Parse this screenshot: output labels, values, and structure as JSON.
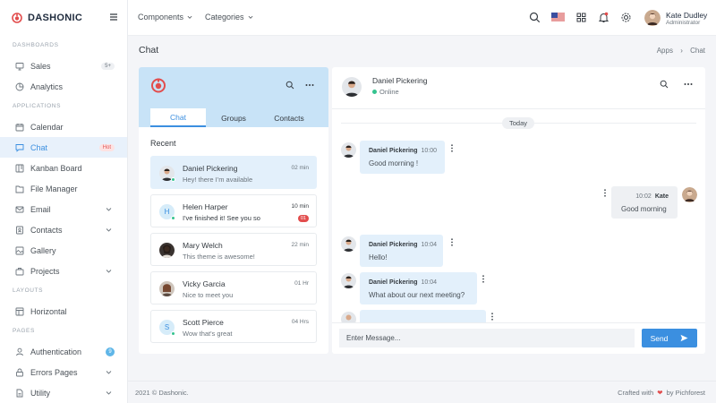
{
  "brand": {
    "name": "DASHONIC",
    "accent": "#e24d4d"
  },
  "sidebar": {
    "sections": [
      {
        "title": "DASHBOARDS"
      },
      {
        "title": "APPLICATIONS"
      },
      {
        "title": "LAYOUTS"
      },
      {
        "title": "PAGES"
      }
    ],
    "items": [
      {
        "label": "Sales",
        "icon": "monitor-icon",
        "badge": "5+"
      },
      {
        "label": "Analytics",
        "icon": "pie-chart-icon"
      },
      {
        "label": "Calendar",
        "icon": "calendar-icon"
      },
      {
        "label": "Chat",
        "icon": "chat-icon",
        "badge": "Hot",
        "active": true
      },
      {
        "label": "Kanban Board",
        "icon": "kanban-icon"
      },
      {
        "label": "File Manager",
        "icon": "folder-icon"
      },
      {
        "label": "Email",
        "icon": "mail-icon"
      },
      {
        "label": "Contacts",
        "icon": "contacts-icon"
      },
      {
        "label": "Gallery",
        "icon": "image-icon"
      },
      {
        "label": "Projects",
        "icon": "briefcase-icon"
      },
      {
        "label": "Horizontal",
        "icon": "layout-icon"
      },
      {
        "label": "Authentication",
        "icon": "user-icon",
        "badge": "9"
      },
      {
        "label": "Errors Pages",
        "icon": "lock-icon"
      },
      {
        "label": "Utility",
        "icon": "file-icon"
      }
    ]
  },
  "topbar": {
    "menus": [
      "Components",
      "Categories"
    ],
    "user": {
      "name": "Kate Dudley",
      "role": "Administrator"
    }
  },
  "page": {
    "title": "Chat",
    "breadcrumb": [
      "Apps",
      "Chat"
    ]
  },
  "chat_list": {
    "tabs": [
      "Chat",
      "Groups",
      "Contacts"
    ],
    "recent_label": "Recent",
    "conversations": [
      {
        "name": "Daniel Pickering",
        "message": "Hey! there I'm available",
        "time": "02 min",
        "status": "online"
      },
      {
        "name": "Helen Harper",
        "message": "I've finished it! See you so",
        "time": "10 min",
        "unread": "01",
        "initial": "H",
        "status": "online"
      },
      {
        "name": "Mary Welch",
        "message": "This theme is awesome!",
        "time": "22 min"
      },
      {
        "name": "Vicky Garcia",
        "message": "Nice to meet you",
        "time": "01 Hr"
      },
      {
        "name": "Scott Pierce",
        "message": "Wow that's great",
        "time": "04 Hrs",
        "initial": "S",
        "status": "online"
      }
    ]
  },
  "conversation": {
    "contact": {
      "name": "Daniel Pickering",
      "status": "Online"
    },
    "day_label": "Today",
    "messages": [
      {
        "sender": "Daniel Pickering",
        "time": "10:00",
        "text": "Good morning !"
      },
      {
        "sender": "Kate",
        "time": "10:02",
        "text": "Good morning",
        "mine": true
      },
      {
        "sender": "Daniel Pickering",
        "time": "10:04",
        "text": "Hello!"
      },
      {
        "sender": "Daniel Pickering",
        "time": "10:04",
        "text": "What about our next meeting?"
      }
    ],
    "input_placeholder": "Enter Message...",
    "send_label": "Send"
  },
  "footer": {
    "left": "2021 © Dashonic.",
    "right_prefix": "Crafted with",
    "right_suffix": "by Pichforest"
  }
}
